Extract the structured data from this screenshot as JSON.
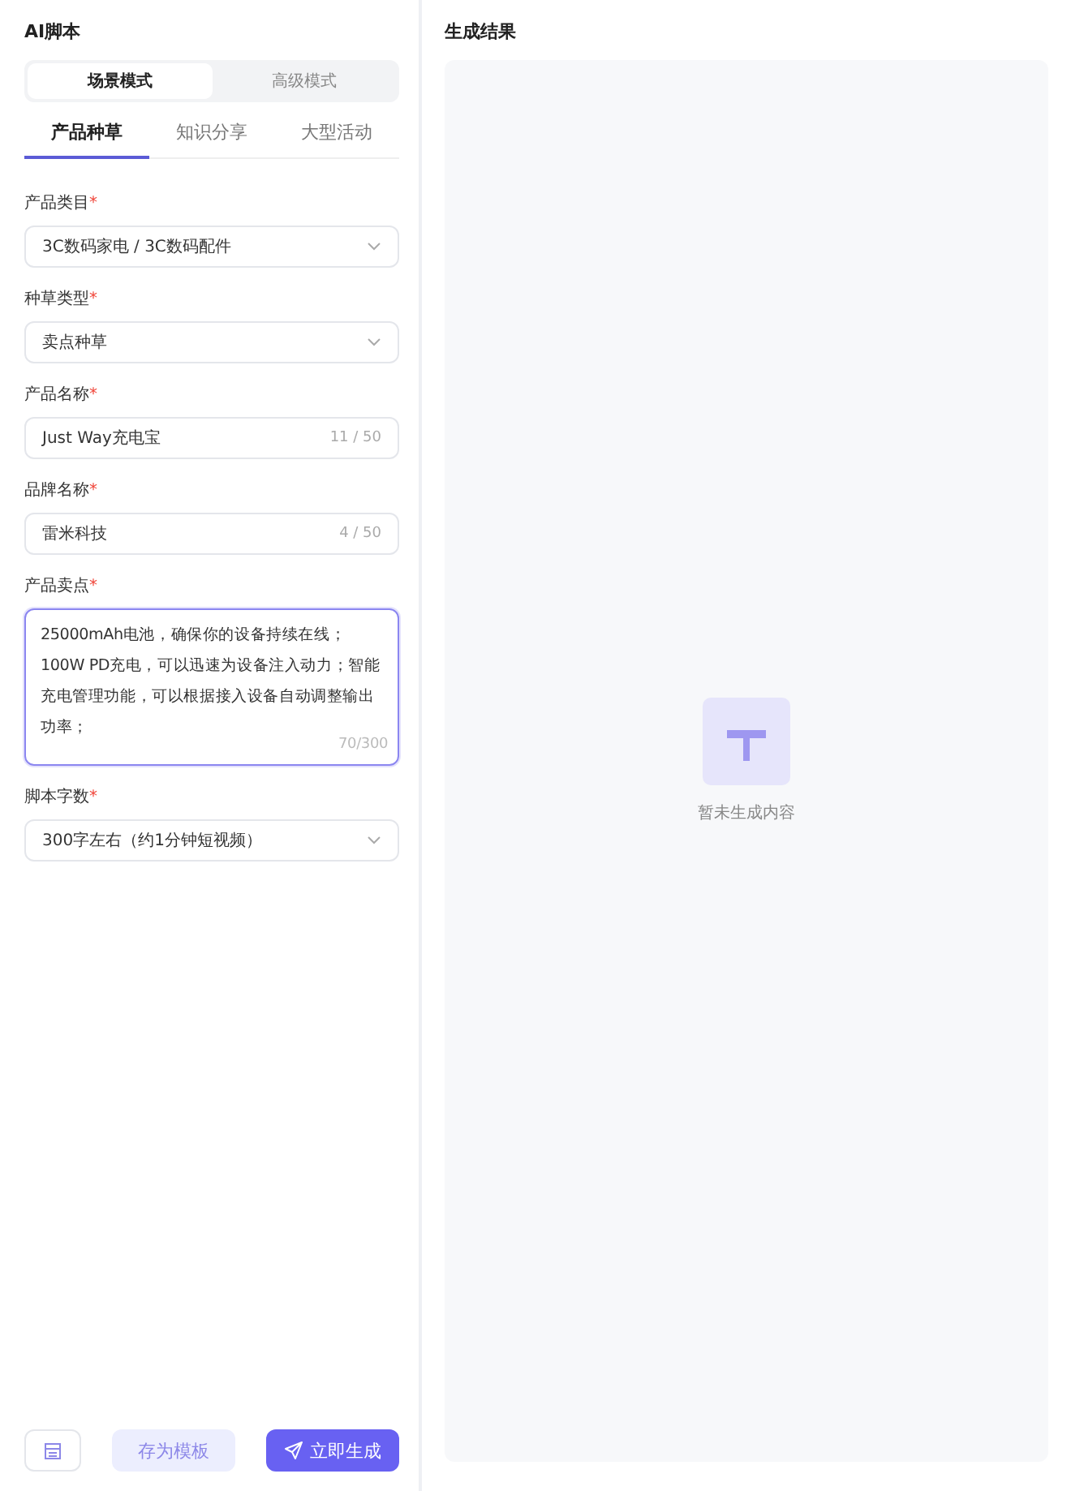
{
  "left_panel": {
    "title": "AI脚本",
    "mode_switch": [
      {
        "label": "场景模式",
        "selected": true
      },
      {
        "label": "高级模式",
        "selected": false
      }
    ],
    "tabs": [
      {
        "label": "产品种草",
        "selected": true
      },
      {
        "label": "知识分享",
        "selected": false
      },
      {
        "label": "大型活动",
        "selected": false
      }
    ],
    "fields": [
      {
        "kind": "select",
        "label": "产品类目",
        "required_mark": "*",
        "value": "3C数码家电 / 3C数码配件"
      },
      {
        "kind": "select",
        "label": "种草类型",
        "required_mark": "*",
        "value": "卖点种草"
      },
      {
        "kind": "input",
        "label": "产品名称",
        "required_mark": "*",
        "value": "Just Way充电宝",
        "count": "11 / 50"
      },
      {
        "kind": "input",
        "label": "品牌名称",
        "required_mark": "*",
        "value": "雷米科技",
        "count": "4 / 50"
      },
      {
        "kind": "textarea",
        "label": "产品卖点",
        "required_mark": "*",
        "value": "25000mAh电池，确保你的设备持续在线；100W PD充电，可以迅速为设备注入动力；智能充电管理功能，可以根据接入设备自动调整输出功率；",
        "count": "70/300",
        "focused": true
      },
      {
        "kind": "select",
        "label": "脚本字数",
        "required_mark": "*",
        "value": "300字左右（约1分钟短视频）"
      }
    ],
    "buttons": [
      {
        "kind": "icon"
      },
      {
        "kind": "secondary",
        "label": "存为模板"
      },
      {
        "kind": "primary",
        "label": "立即生成"
      }
    ]
  },
  "result_panel": {
    "title": "生成结果",
    "empty_text": "暂未生成内容"
  }
}
